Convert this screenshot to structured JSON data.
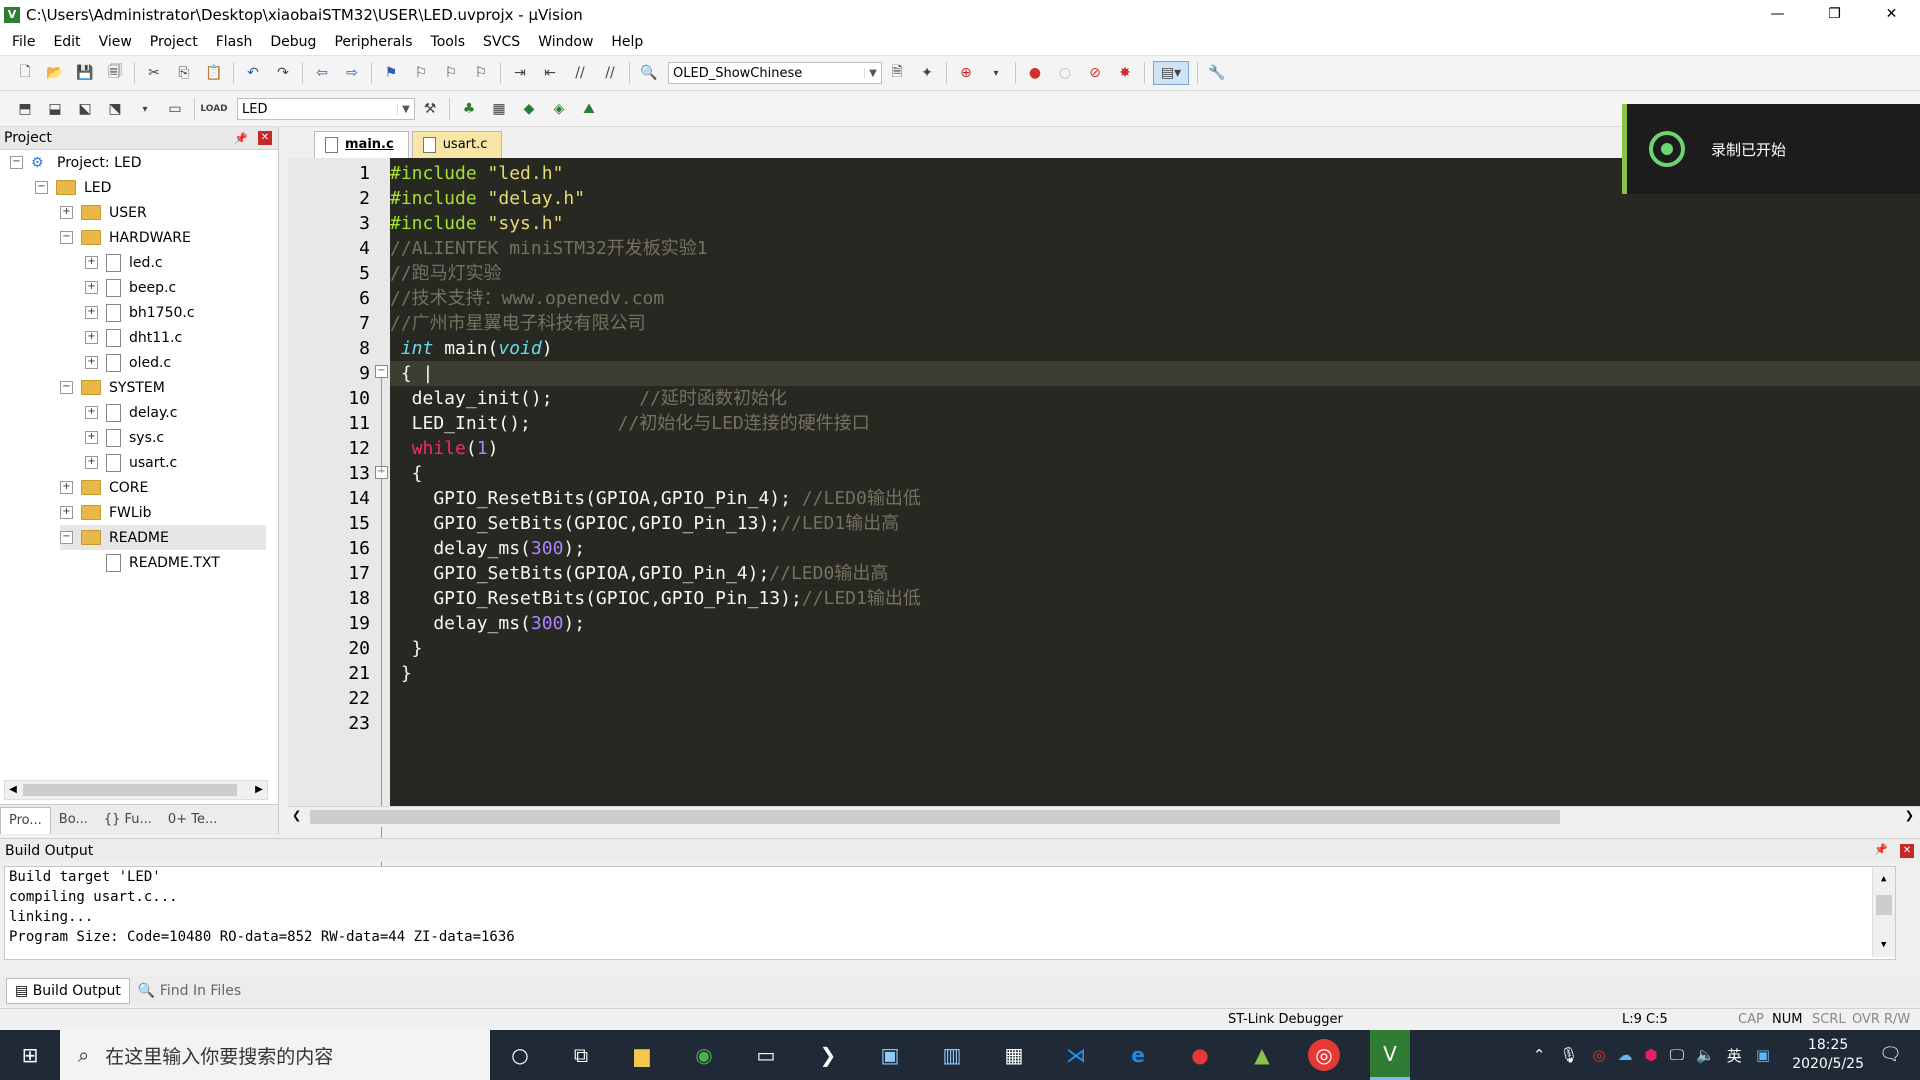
{
  "window": {
    "title": "C:\\Users\\Administrator\\Desktop\\xiaobaiSTM32\\USER\\LED.uvprojx - µVision",
    "controls": [
      "—",
      "❐",
      "✕"
    ]
  },
  "menu": [
    "File",
    "Edit",
    "View",
    "Project",
    "Flash",
    "Debug",
    "Peripherals",
    "Tools",
    "SVCS",
    "Window",
    "Help"
  ],
  "toolbar1": {
    "function_combo": "OLED_ShowChinese"
  },
  "toolbar2": {
    "target_combo": "LED"
  },
  "project_panel": {
    "title": "Project",
    "tree": [
      {
        "label": "Project: LED",
        "level": 0,
        "type": "project",
        "exp": "−"
      },
      {
        "label": "LED",
        "level": 1,
        "type": "target",
        "exp": "−"
      },
      {
        "label": "USER",
        "level": 2,
        "type": "folder",
        "exp": "+"
      },
      {
        "label": "HARDWARE",
        "level": 2,
        "type": "folder",
        "exp": "−"
      },
      {
        "label": "led.c",
        "level": 3,
        "type": "file",
        "exp": "+"
      },
      {
        "label": "beep.c",
        "level": 3,
        "type": "file",
        "exp": "+"
      },
      {
        "label": "bh1750.c",
        "level": 3,
        "type": "file",
        "exp": "+"
      },
      {
        "label": "dht11.c",
        "level": 3,
        "type": "file",
        "exp": "+"
      },
      {
        "label": "oled.c",
        "level": 3,
        "type": "file",
        "exp": "+"
      },
      {
        "label": "SYSTEM",
        "level": 2,
        "type": "folder",
        "exp": "−"
      },
      {
        "label": "delay.c",
        "level": 3,
        "type": "file",
        "exp": "+"
      },
      {
        "label": "sys.c",
        "level": 3,
        "type": "file",
        "exp": "+"
      },
      {
        "label": "usart.c",
        "level": 3,
        "type": "file",
        "exp": "+"
      },
      {
        "label": "CORE",
        "level": 2,
        "type": "folder",
        "exp": "+"
      },
      {
        "label": "FWLib",
        "level": 2,
        "type": "folder",
        "exp": "+"
      },
      {
        "label": "README",
        "level": 2,
        "type": "folder",
        "exp": "−"
      },
      {
        "label": "README.TXT",
        "level": 3,
        "type": "file",
        "exp": ""
      }
    ],
    "tabs": [
      "Pro...",
      "Bo...",
      "{} Fu...",
      "0+ Te..."
    ]
  },
  "editor": {
    "tabs": [
      {
        "label": "main.c",
        "active": true
      },
      {
        "label": "usart.c",
        "active": false
      }
    ],
    "current_line": 9,
    "lines": [
      [
        [
          "kw-inc",
          "#include "
        ],
        [
          "str",
          "\"led.h\""
        ]
      ],
      [
        [
          "kw-inc",
          "#include "
        ],
        [
          "str",
          "\"delay.h\""
        ]
      ],
      [
        [
          "kw-inc",
          "#include "
        ],
        [
          "str",
          "\"sys.h\""
        ]
      ],
      [
        [
          "cmt",
          "//ALIENTEK miniSTM32开发板实验1"
        ]
      ],
      [
        [
          "cmt",
          "//跑马灯实验"
        ]
      ],
      [
        [
          "cmt",
          "//技术支持：www.openedv.com"
        ]
      ],
      [
        [
          "cmt",
          "//广州市星翼电子科技有限公司"
        ]
      ],
      [
        [
          "",
          " "
        ],
        [
          "type",
          "int"
        ],
        [
          "",
          " main("
        ],
        [
          "type",
          "void"
        ],
        [
          "",
          ")"
        ]
      ],
      [
        [
          "",
          " { "
        ],
        [
          "",
          "|"
        ]
      ],
      [
        [
          "",
          "  delay_init();        "
        ],
        [
          "cmt",
          "//延时函数初始化"
        ]
      ],
      [
        [
          "",
          "  LED_Init();        "
        ],
        [
          "cmt",
          "//初始化与LED连接的硬件接口"
        ]
      ],
      [
        [
          "",
          "  "
        ],
        [
          "kw",
          "while"
        ],
        [
          "",
          "("
        ],
        [
          "num",
          "1"
        ],
        [
          "",
          ")"
        ]
      ],
      [
        [
          "",
          "  {"
        ]
      ],
      [
        [
          "",
          "    GPIO_ResetBits(GPIOA,GPIO_Pin_4); "
        ],
        [
          "cmt",
          "//LED0输出低"
        ]
      ],
      [
        [
          "",
          "    GPIO_SetBits(GPIOC,GPIO_Pin_13);"
        ],
        [
          "cmt",
          "//LED1输出高"
        ]
      ],
      [
        [
          "",
          "    delay_ms("
        ],
        [
          "num",
          "300"
        ],
        [
          "",
          ");"
        ]
      ],
      [
        [
          "",
          "    GPIO_SetBits(GPIOA,GPIO_Pin_4);"
        ],
        [
          "cmt",
          "//LED0输出高"
        ]
      ],
      [
        [
          "",
          "    GPIO_ResetBits(GPIOC,GPIO_Pin_13);"
        ],
        [
          "cmt",
          "//LED1输出低"
        ]
      ],
      [
        [
          "",
          "    delay_ms("
        ],
        [
          "num",
          "300"
        ],
        [
          "",
          ");"
        ]
      ],
      [
        [
          "",
          "  }"
        ]
      ],
      [
        [
          "",
          " }"
        ]
      ],
      [
        [
          "",
          ""
        ]
      ],
      [
        [
          "",
          ""
        ]
      ]
    ]
  },
  "toast": {
    "text": "录制已开始"
  },
  "build_output": {
    "title": "Build Output",
    "lines": [
      "Build target 'LED'",
      "compiling usart.c...",
      "linking...",
      "Program Size: Code=10480 RO-data=852 RW-data=44 ZI-data=1636"
    ],
    "tabs": [
      "Build Output",
      "Find In Files"
    ]
  },
  "status": {
    "debugger": "ST-Link Debugger",
    "cursor": "L:9 C:5",
    "flags": [
      "CAP",
      "NUM",
      "SCRL",
      "OVR",
      "R/W"
    ]
  },
  "taskbar": {
    "search_placeholder": "在这里输入你要搜索的内容",
    "time": "18:25",
    "date": "2020/5/25",
    "ime": "英"
  }
}
